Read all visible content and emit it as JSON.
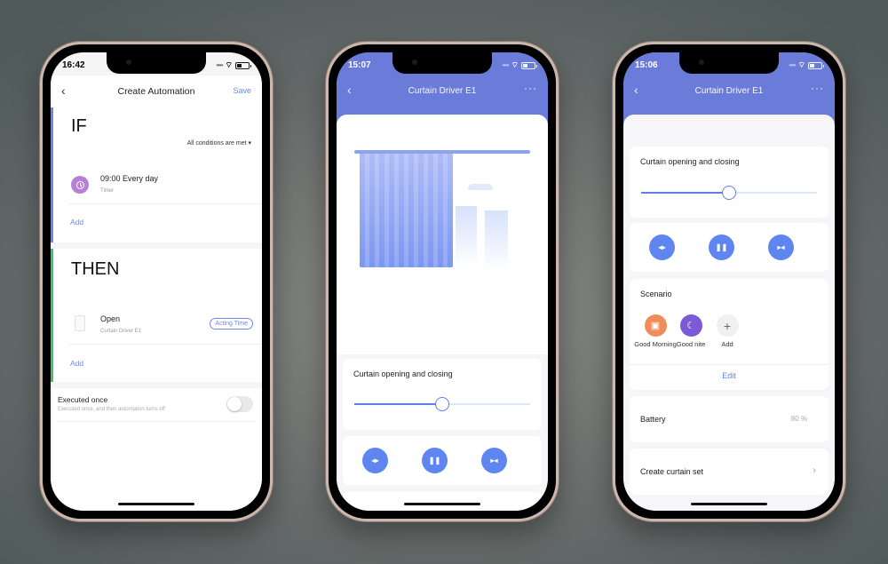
{
  "phones": [
    {
      "status_time": "16:42",
      "nav": {
        "back_icon": "chevron-left",
        "title": "Create Automation",
        "action": "Save"
      },
      "if_section": {
        "heading": "IF",
        "condition_mode": "All conditions are met",
        "conditions": [
          {
            "title": "09:00 Every day",
            "subtitle": "Timer",
            "icon": "clock-icon"
          }
        ],
        "add_label": "Add"
      },
      "then_section": {
        "heading": "THEN",
        "actions": [
          {
            "title": "Open",
            "subtitle": "Curtain Driver E1",
            "badge": "Acting Time",
            "icon": "device-icon"
          }
        ],
        "add_label": "Add"
      },
      "executed_once": {
        "title": "Executed once",
        "subtitle": "Executed once, and then automation turns off",
        "enabled": false
      }
    },
    {
      "status_time": "15:07",
      "nav": {
        "back_icon": "chevron-left",
        "title": "Curtain Driver E1",
        "more_icon": "more-icon"
      },
      "slider": {
        "label": "Curtain opening and closing",
        "value_percent": 50
      },
      "controls": [
        {
          "name": "open",
          "glyph": "◂▸"
        },
        {
          "name": "pause",
          "glyph": "❚❚"
        },
        {
          "name": "close",
          "glyph": "▸◂"
        }
      ]
    },
    {
      "status_time": "15:06",
      "nav": {
        "back_icon": "chevron-left",
        "title": "Curtain Driver E1",
        "more_icon": "more-icon"
      },
      "slider": {
        "label": "Curtain opening and closing",
        "value_percent": 50
      },
      "controls": [
        {
          "name": "open",
          "glyph": "◂▸"
        },
        {
          "name": "pause",
          "glyph": "❚❚"
        },
        {
          "name": "close",
          "glyph": "▸◂"
        }
      ],
      "scenario": {
        "title": "Scenario",
        "items": [
          {
            "label": "Good Morning",
            "icon": "toaster-icon",
            "color": "#ef8d5a"
          },
          {
            "label": "Good nite",
            "icon": "moon-icon",
            "color": "#7a5ad8"
          },
          {
            "label": "Add",
            "icon": "plus-icon",
            "color": "#f0f0f0"
          }
        ],
        "edit_label": "Edit"
      },
      "battery": {
        "label": "Battery",
        "value": "80 %"
      },
      "create_set": {
        "label": "Create curtain set"
      }
    }
  ],
  "colors": {
    "accent": "#6a7bd9",
    "button": "#5f86f0",
    "if_bar": "#6b86e8",
    "then_bar": "#3fc26a",
    "link": "#6c88e8"
  }
}
